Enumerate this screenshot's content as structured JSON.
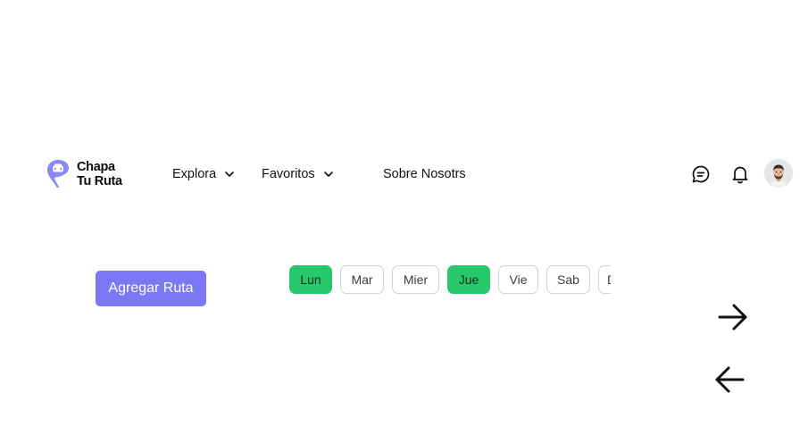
{
  "brand": {
    "line1": "Chapa",
    "line2": "Tu Ruta",
    "accent_color": "#8b87f7"
  },
  "nav": {
    "items": [
      {
        "label": "Explora",
        "has_dropdown": true
      },
      {
        "label": "Favoritos",
        "has_dropdown": true
      },
      {
        "label": "Sobre Nosotrs",
        "has_dropdown": false
      }
    ]
  },
  "header_icons": {
    "chat": "chat-bubble-icon",
    "notifications": "bell-icon",
    "profile": "user-avatar"
  },
  "actions": {
    "add_route_label": "Agregar Ruta",
    "add_route_color": "#7b78f6"
  },
  "days": {
    "active_color": "#27c76c",
    "items": [
      {
        "label": "Lun",
        "active": true
      },
      {
        "label": "Mar",
        "active": false
      },
      {
        "label": "Mier",
        "active": false
      },
      {
        "label": "Jue",
        "active": true
      },
      {
        "label": "Vie",
        "active": false
      },
      {
        "label": "Sab",
        "active": false
      },
      {
        "label": "Dom",
        "active": false
      }
    ]
  },
  "pager": {
    "next_icon": "arrow-right-icon",
    "prev_icon": "arrow-left-icon"
  }
}
